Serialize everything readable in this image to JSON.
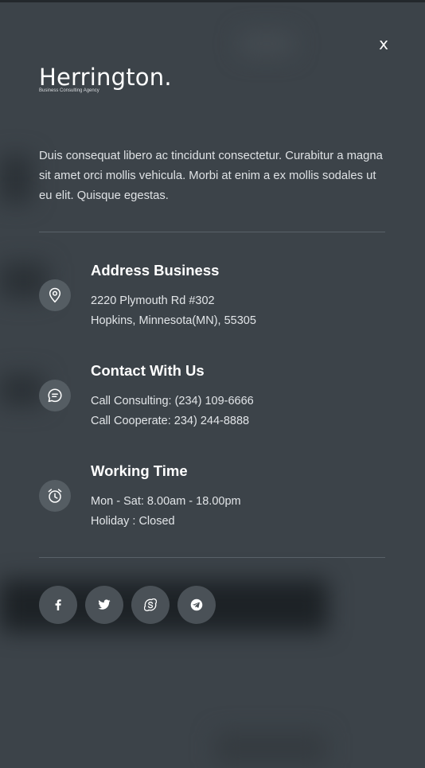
{
  "close": {
    "label": "x"
  },
  "logo": {
    "name": "Herrington.",
    "tagline": "Business Consulting Agency"
  },
  "intro": {
    "text": "Duis consequat libero ac tincidunt consectetur. Curabitur a magna sit amet orci mollis vehicula. Morbi at enim a ex mollis sodales ut eu elit. Quisque egestas."
  },
  "address": {
    "title": "Address Business",
    "line1": "2220 Plymouth Rd #302",
    "line2": "Hopkins, Minnesota(MN), 55305",
    "icon": "map-pin-icon"
  },
  "contact": {
    "title": "Contact With Us",
    "line1": "Call Consulting: (234) 109-6666",
    "line2": "Call Cooperate: 234) 244-8888",
    "icon": "chat-icon"
  },
  "hours": {
    "title": "Working Time",
    "line1": "Mon - Sat: 8.00am - 18.00pm",
    "line2": "Holiday : Closed",
    "icon": "alarm-clock-icon"
  },
  "socials": [
    "facebook-icon",
    "twitter-icon",
    "skype-icon",
    "telegram-icon"
  ],
  "colors": {
    "background": "#3c4349",
    "icon_circle": "#555d63",
    "social_circle": "#4a5157",
    "text": "#ffffff"
  }
}
